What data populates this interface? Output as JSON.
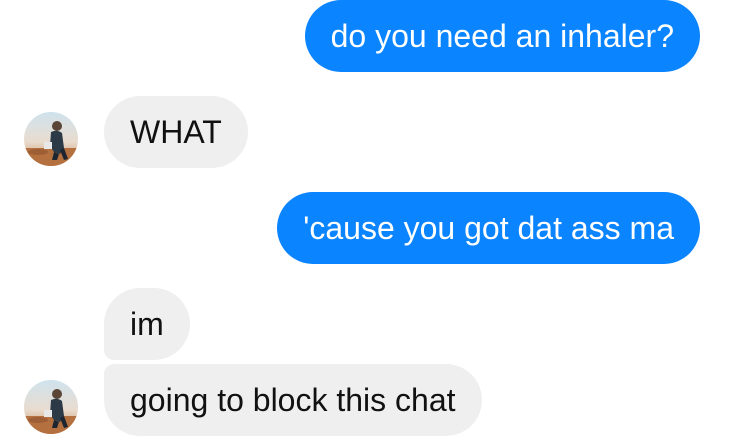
{
  "conversation": {
    "messages": [
      {
        "sender": "me",
        "text": "do you need an inhaler?"
      },
      {
        "sender": "them",
        "text": "WHAT"
      },
      {
        "sender": "me",
        "text": "'cause you got dat ass ma"
      },
      {
        "sender": "them",
        "text": "im"
      },
      {
        "sender": "them",
        "text": "going to block this chat"
      }
    ]
  },
  "colors": {
    "sent_bubble": "#0b84ff",
    "received_bubble": "#efefef",
    "background": "#ffffff"
  },
  "icons": {
    "avatar": "contact-avatar-photo"
  }
}
